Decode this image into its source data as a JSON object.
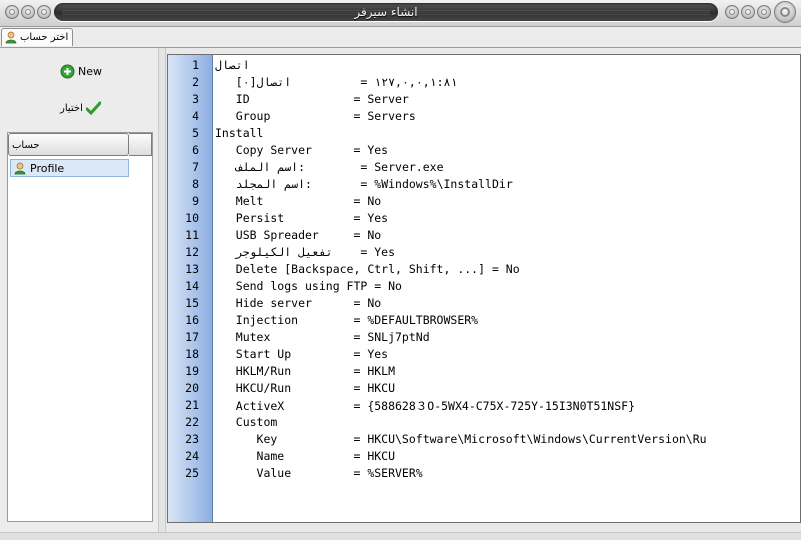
{
  "window": {
    "title": "انشاء سيرفر"
  },
  "tabs": [
    {
      "label": "اختر حساب"
    }
  ],
  "toolbar": {
    "new_label": "New",
    "select_label": "اختيار"
  },
  "tree": {
    "header": "حساب",
    "items": [
      {
        "label": "Profile"
      }
    ]
  },
  "colors": {
    "gutter": "#aac4ea",
    "selection": "#dbe8f7",
    "new_icon": "#3aa336",
    "check_icon": "#2e9a2a"
  },
  "editor": {
    "line_numbers": [
      "1",
      "2",
      "3",
      "4",
      "5",
      "6",
      "7",
      "8",
      "9",
      "10",
      "11",
      "12",
      "13",
      "14",
      "15",
      "16",
      "17",
      "18",
      "19",
      "20",
      "21",
      "22",
      "23",
      "24",
      "25"
    ],
    "lines": [
      "اتصال",
      "   ١٢٧,٠,٠,١:٨١ =          اتصال[٠]",
      "   ID               = Server",
      "   Group            = Servers",
      "Install",
      "   Copy Server      = Yes",
      "   اسم الملف:        = Server.exe",
      "   اسم المجلد:       = %Windows%\\InstallDir",
      "   Melt             = No",
      "   Persist          = Yes",
      "   USB Spreader     = No",
      "   تفعيل الكيلوجر    = Yes",
      "   Delete [Backspace, Ctrl, Shift, ...] = No",
      "   Send logs using FTP = No",
      "   Hide server      = No",
      "   Injection        = %DEFAULTBROWSER%",
      "   Mutex            = SNLj7ptNd",
      "   Start Up         = Yes",
      "   HKLM/Run         = HKLM",
      "   HKCU/Run         = HKCU",
      "   ActiveX          = {588628３O-5WX4-C75X-725Y-15I3N0T51NSF}",
      "   Custom",
      "      Key           = HKCU\\Software\\Microsoft\\Windows\\CurrentVersion\\Ru",
      "      Name          = HKCU",
      "      Value         = %SERVER%"
    ]
  }
}
